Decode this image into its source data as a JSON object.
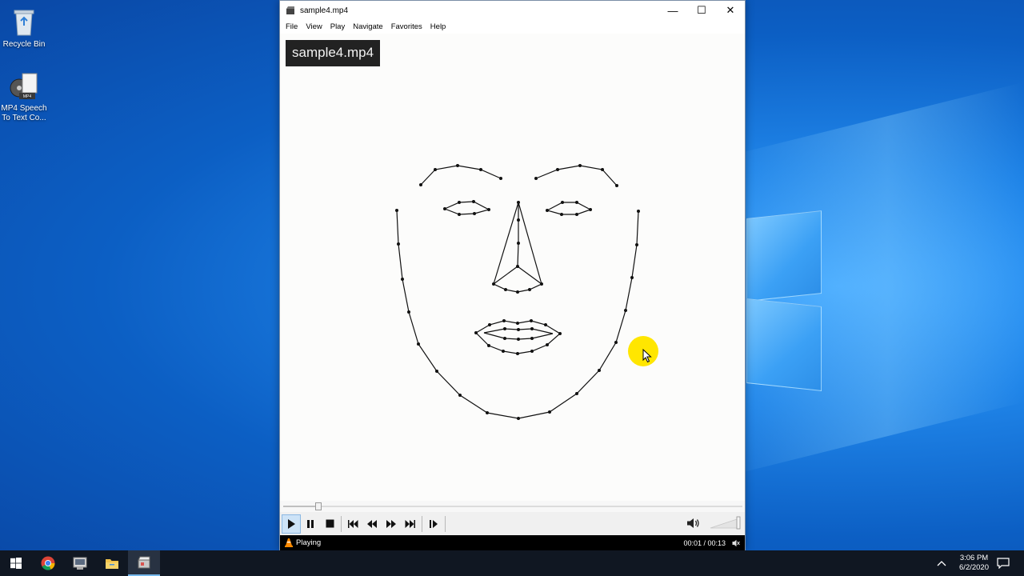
{
  "desktop": {
    "icons": [
      {
        "label": "Recycle Bin",
        "icon": "recycle-bin-icon"
      },
      {
        "label": "MP4 Speech To Text Co...",
        "icon": "mp4-converter-icon"
      }
    ]
  },
  "window": {
    "title": "sample4.mp4",
    "menu": [
      "File",
      "View",
      "Play",
      "Navigate",
      "Favorites",
      "Help"
    ],
    "controls": {
      "minimize": "—",
      "maximize": "☐",
      "close": "✕"
    }
  },
  "video": {
    "osd_title": "sample4.mp4",
    "content": "face-landmarks-drawing"
  },
  "playback": {
    "progress": 0.077,
    "volume_icon": "speaker-icon",
    "buttons": [
      "play",
      "pause",
      "stop",
      "previous",
      "rewind",
      "fast-forward",
      "next",
      "frame-step"
    ]
  },
  "status": {
    "state": "Playing",
    "time": "00:01 / 00:13"
  },
  "taskbar": {
    "items": [
      "start-icon",
      "chrome-icon",
      "installer-icon",
      "file-explorer-icon",
      "media-player-icon"
    ],
    "clock_time": "3:06 PM",
    "clock_date": "6/2/2020"
  },
  "colors": {
    "desktop_blue": "#1f84e8",
    "taskbar": "#101722",
    "cursor_highlight": "#ffe600",
    "active_button": "#cde3f7"
  }
}
